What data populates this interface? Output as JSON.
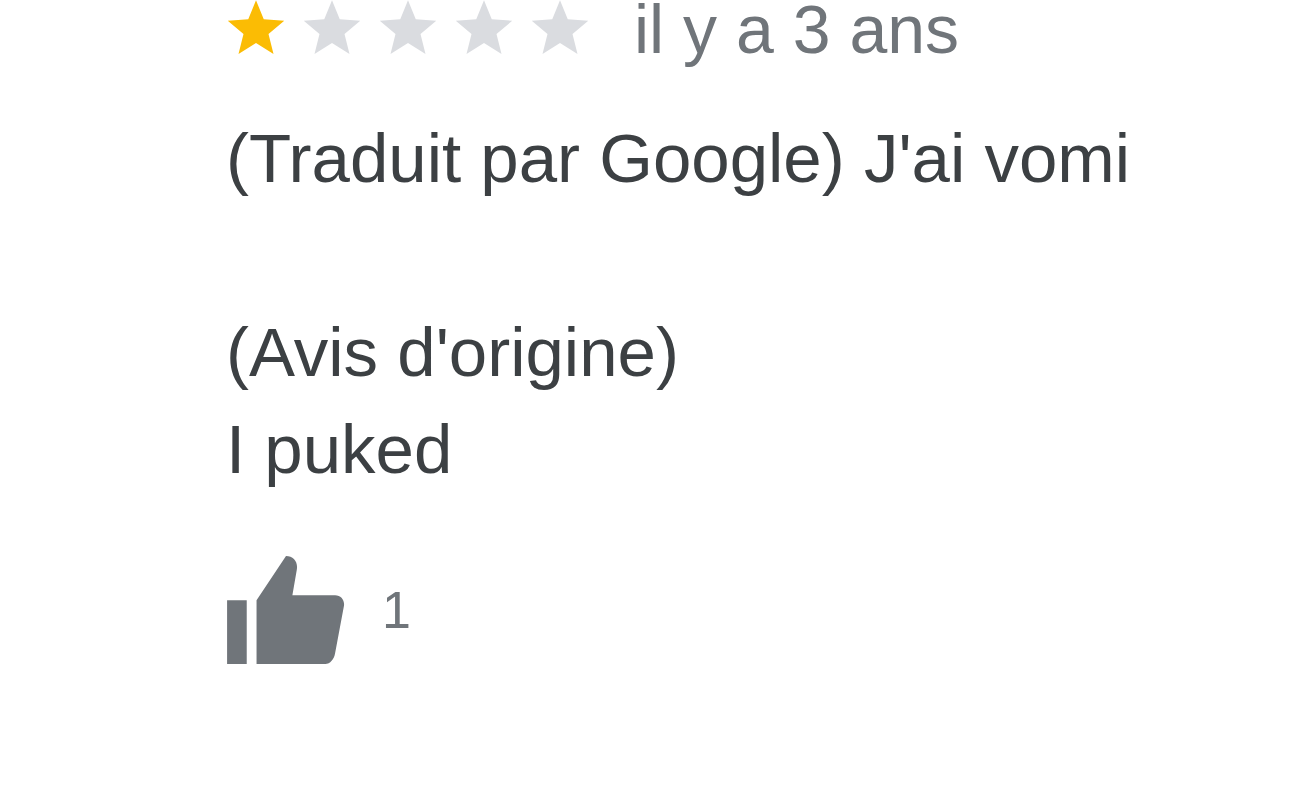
{
  "review": {
    "stars": 1,
    "date": "il y a 3 ans",
    "translation": "(Traduit par Google) J'ai vomi",
    "original_heading": "(Avis d'origine)",
    "original_text": "I puked",
    "like_count": "1"
  }
}
